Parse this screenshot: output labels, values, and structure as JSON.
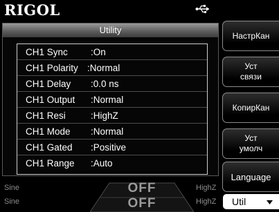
{
  "header": {
    "brand": "RIGOL",
    "usb_icon": "usb-icon"
  },
  "panel": {
    "title": "Utility",
    "rows": [
      {
        "param": "CH1 Sync",
        "value": ":On"
      },
      {
        "param": "CH1 Polarity",
        "value": ":Normal"
      },
      {
        "param": "CH1 Delay",
        "value": ":0.0 ns"
      },
      {
        "param": "CH1 Output",
        "value": ":Normal"
      },
      {
        "param": "CH1 Resi",
        "value": ":HighZ"
      },
      {
        "param": "CH1 Mode",
        "value": ":Normal"
      },
      {
        "param": "CH1 Gated",
        "value": ":Positive"
      },
      {
        "param": "CH1 Range",
        "value": ":Auto"
      }
    ]
  },
  "status": {
    "ch1": {
      "waveform": "Sine",
      "state": "OFF",
      "impedance": "HighZ"
    },
    "ch2": {
      "waveform": "Sine",
      "state": "OFF",
      "impedance": "HighZ"
    }
  },
  "menu": {
    "items": [
      {
        "line1": "НастрКан",
        "line2": ""
      },
      {
        "line1": "Уст",
        "line2": "связи"
      },
      {
        "line1": "КопирКан",
        "line2": ""
      },
      {
        "line1": "Уст",
        "line2": "умолч"
      },
      {
        "line1": "Language",
        "line2": ""
      }
    ],
    "util_tab": {
      "label": "Util",
      "arrow_icon": "triangle-down-icon"
    }
  },
  "colors": {
    "background": "#000000",
    "title_bar": "#7a7a7a",
    "status_text": "#8c8c8c",
    "util_tab_bg": "#ffffff"
  }
}
